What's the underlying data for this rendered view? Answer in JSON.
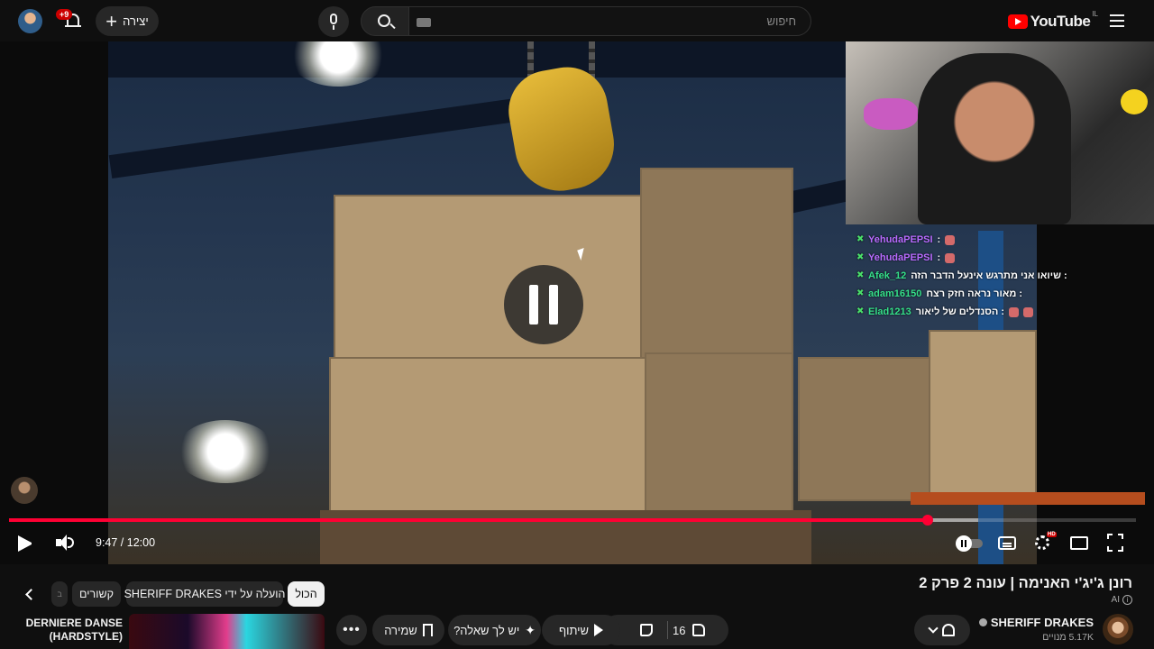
{
  "header": {
    "logo_text": "YouTube",
    "country_code": "IL",
    "search_placeholder": "חיפוש",
    "create_label": "יצירה",
    "notifications_badge": "+9"
  },
  "player": {
    "current_time": "9:47",
    "duration": "12:00",
    "time_display": "9:47 / 12:00",
    "progress_fraction": 0.815,
    "buffer_fraction": 0.86,
    "state": "playing",
    "settings_badge": "HD",
    "icons": [
      "play-icon",
      "volume-icon",
      "autoplay-toggle",
      "subtitles-icon",
      "settings-gear-icon",
      "theater-mode-icon",
      "fullscreen-icon"
    ]
  },
  "stream_chat": [
    {
      "user": "YehudaPEPSI",
      "message": ":",
      "color": "#b86bff",
      "emotes": 1
    },
    {
      "user": "YehudaPEPSI",
      "message": ":",
      "color": "#b86bff",
      "emotes": 1
    },
    {
      "user": "Afek_12",
      "message": ": שיואו אני מתרגש אינעל הדבר הזה",
      "color": "#35e08a",
      "emotes": 0
    },
    {
      "user": "adam16150",
      "message": ": מאור נראה חזק רצח",
      "color": "#35e08a",
      "emotes": 0
    },
    {
      "user": "Elad1213",
      "message": ": הסנדלים של ליאור",
      "color": "#35e08a",
      "emotes": 2
    }
  ],
  "video": {
    "title": "רונן ג'יג'י האנימה | עונה 2 פרק 2",
    "ai_label": "AI",
    "channel_name": "SHERIFF DRAKES",
    "subscribers": "5.17K מנויים",
    "likes": "16",
    "share_label": "שיתוף",
    "ask_label": "יש לך שאלה?",
    "save_label": "שמירה",
    "more_label": "•••"
  },
  "chips": {
    "all": "הכול",
    "uploader": "הועלה על ידי SHERIFF DRAKES",
    "related": "קשורים",
    "more": "ב"
  },
  "recommendation": {
    "title": "DERNIERE DANSE (HARDSTYLE)"
  },
  "colors": {
    "background": "#0f0f0f",
    "accent_red": "#ff0033",
    "pill": "#272727"
  }
}
